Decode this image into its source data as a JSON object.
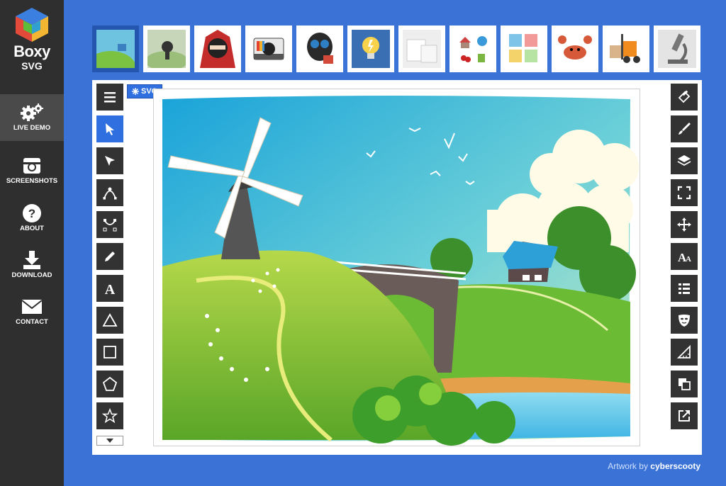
{
  "app": {
    "name_line1": "Boxy",
    "name_line2": "SVG"
  },
  "nav": [
    {
      "label": "LIVE DEMO",
      "icon": "gears-icon",
      "active": true
    },
    {
      "label": "SCREENSHOTS",
      "icon": "camera-icon",
      "active": false
    },
    {
      "label": "ABOUT",
      "icon": "question-icon",
      "active": false
    },
    {
      "label": "DOWNLOAD",
      "icon": "download-icon",
      "active": false
    },
    {
      "label": "CONTACT",
      "icon": "envelope-icon",
      "active": false
    }
  ],
  "thumbnails": [
    {
      "name": "landscape",
      "active": true
    },
    {
      "name": "runner"
    },
    {
      "name": "ninja"
    },
    {
      "name": "instant-camera"
    },
    {
      "name": "gas-mask"
    },
    {
      "name": "light-bulb"
    },
    {
      "name": "white-boxes"
    },
    {
      "name": "icon-set"
    },
    {
      "name": "sticky-notes"
    },
    {
      "name": "crab"
    },
    {
      "name": "forklift"
    },
    {
      "name": "microscope"
    }
  ],
  "badge": {
    "label": "SVG"
  },
  "left_tools": [
    "menu-icon",
    "select-arrow-icon",
    "direct-select-icon",
    "path-edit-icon",
    "node-edit-icon",
    "pencil-icon",
    "text-tool-icon",
    "triangle-icon",
    "rectangle-icon",
    "pentagon-icon",
    "star-icon"
  ],
  "right_tools": [
    "fill-bucket-icon",
    "brush-icon",
    "layers-icon",
    "fullscreen-icon",
    "move-icon",
    "font-icon",
    "list-icon",
    "mask-icon",
    "ruler-icon",
    "clone-icon",
    "export-icon"
  ],
  "credit": {
    "prefix": "Artwork by",
    "author": "cyberscooty"
  },
  "colors": {
    "background": "#3a72d6",
    "sidebar": "#2f2f2f",
    "tool": "#333333",
    "accent": "#2f6fe0"
  }
}
